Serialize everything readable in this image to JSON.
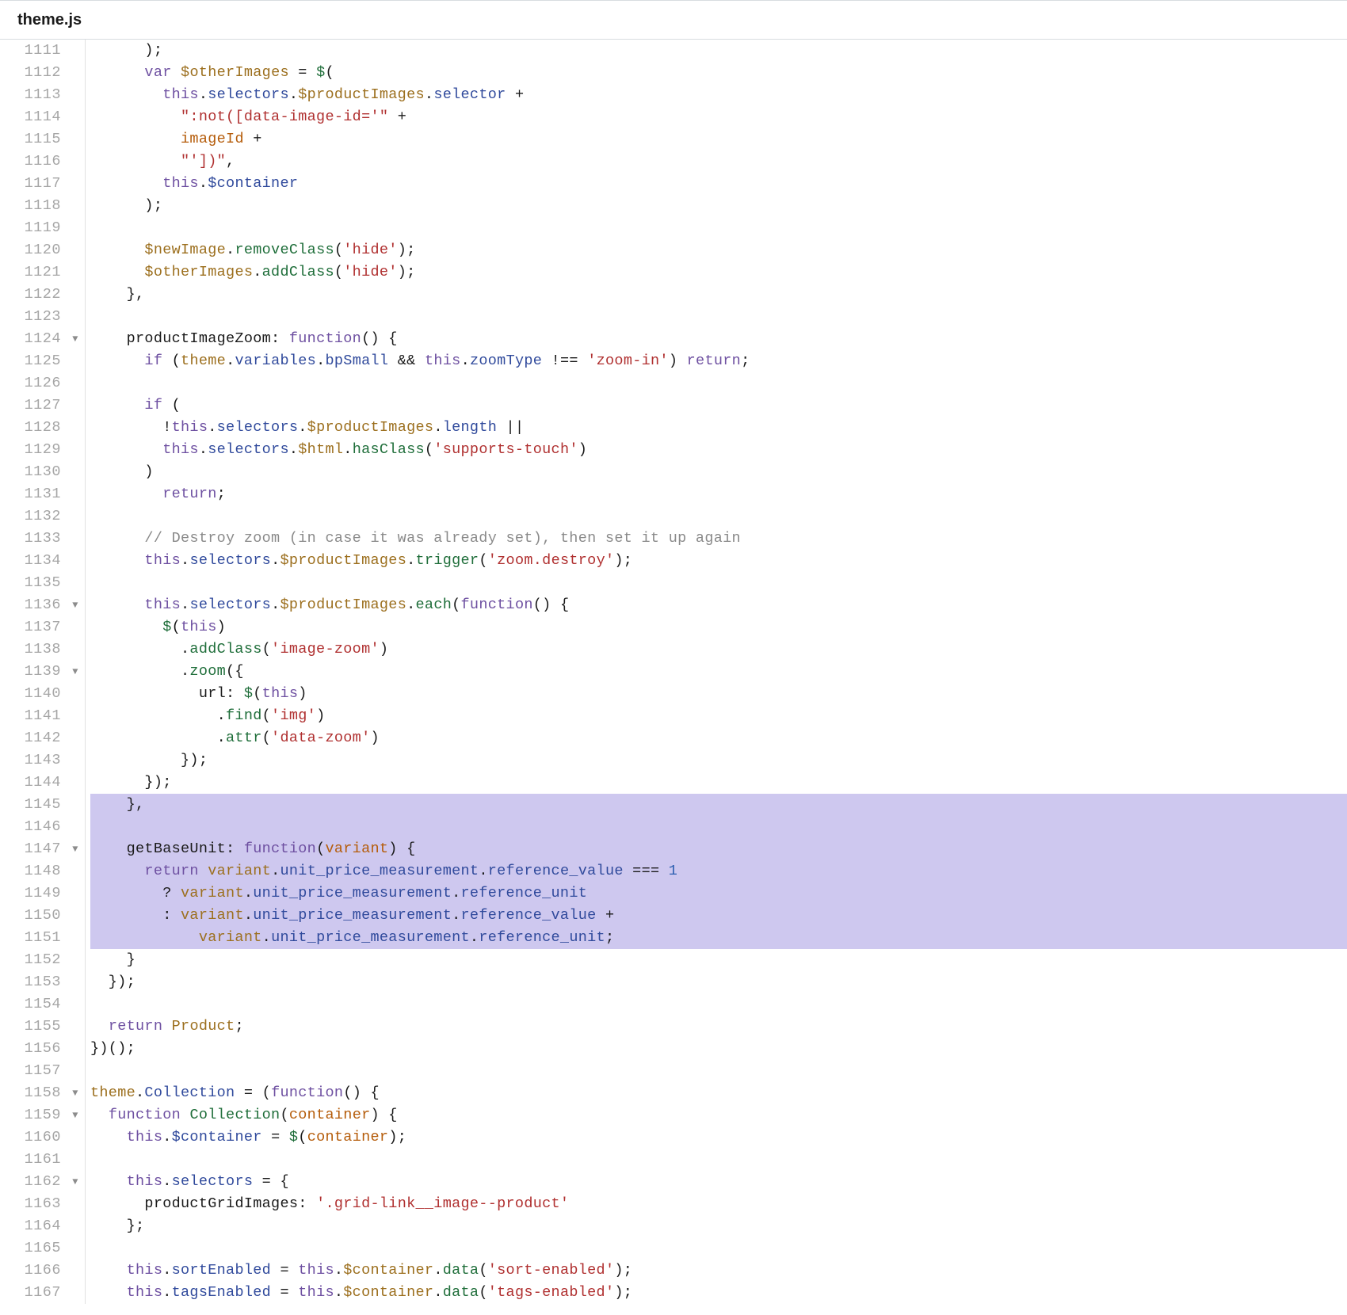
{
  "header": {
    "filename": "theme.js"
  },
  "gutter": {
    "start": 1111,
    "end": 1167,
    "folds": [
      1124,
      1136,
      1139,
      1147,
      1158,
      1159,
      1162
    ]
  },
  "code": {
    "highlight_start": 1145,
    "highlight_end": 1151,
    "lines": {
      "1111": [
        [
          "      );",
          "punc"
        ]
      ],
      "1112": [
        [
          "      ",
          ""
        ],
        [
          "var",
          "kw"
        ],
        [
          " ",
          ""
        ],
        [
          "$otherImages",
          "obj"
        ],
        [
          " ",
          ""
        ],
        [
          "=",
          "op"
        ],
        [
          " ",
          ""
        ],
        [
          "$",
          "fn"
        ],
        [
          "(",
          "punc"
        ]
      ],
      "1113": [
        [
          "        ",
          ""
        ],
        [
          "this",
          "kw"
        ],
        [
          ".",
          "punc"
        ],
        [
          "selectors",
          "prop"
        ],
        [
          ".",
          "punc"
        ],
        [
          "$productImages",
          "obj"
        ],
        [
          ".",
          "punc"
        ],
        [
          "selector",
          "prop"
        ],
        [
          " ",
          ""
        ],
        [
          "+",
          "op"
        ]
      ],
      "1114": [
        [
          "          ",
          ""
        ],
        [
          "\":not([data-image-id='\"",
          "str"
        ],
        [
          " ",
          ""
        ],
        [
          "+",
          "op"
        ]
      ],
      "1115": [
        [
          "          ",
          ""
        ],
        [
          "imageId",
          "param"
        ],
        [
          " ",
          ""
        ],
        [
          "+",
          "op"
        ]
      ],
      "1116": [
        [
          "          ",
          ""
        ],
        [
          "\"'])\"",
          "str"
        ],
        [
          ",",
          "punc"
        ]
      ],
      "1117": [
        [
          "        ",
          ""
        ],
        [
          "this",
          "kw"
        ],
        [
          ".",
          "punc"
        ],
        [
          "$container",
          "prop"
        ]
      ],
      "1118": [
        [
          "      );",
          "punc"
        ]
      ],
      "1119": [
        [
          "",
          ""
        ]
      ],
      "1120": [
        [
          "      ",
          ""
        ],
        [
          "$newImage",
          "obj"
        ],
        [
          ".",
          "punc"
        ],
        [
          "removeClass",
          "fn"
        ],
        [
          "(",
          "punc"
        ],
        [
          "'hide'",
          "str"
        ],
        [
          ");",
          "punc"
        ]
      ],
      "1121": [
        [
          "      ",
          ""
        ],
        [
          "$otherImages",
          "obj"
        ],
        [
          ".",
          "punc"
        ],
        [
          "addClass",
          "fn"
        ],
        [
          "(",
          "punc"
        ],
        [
          "'hide'",
          "str"
        ],
        [
          ");",
          "punc"
        ]
      ],
      "1122": [
        [
          "    },",
          "punc"
        ]
      ],
      "1123": [
        [
          "",
          ""
        ]
      ],
      "1124": [
        [
          "    ",
          ""
        ],
        [
          "productImageZoom",
          "ident"
        ],
        [
          ":",
          "punc"
        ],
        [
          " ",
          ""
        ],
        [
          "function",
          "kw"
        ],
        [
          "()",
          "punc"
        ],
        [
          " ",
          ""
        ],
        [
          "{",
          "punc"
        ]
      ],
      "1125": [
        [
          "      ",
          ""
        ],
        [
          "if",
          "kw"
        ],
        [
          " (",
          "punc"
        ],
        [
          "theme",
          "obj"
        ],
        [
          ".",
          "punc"
        ],
        [
          "variables",
          "prop"
        ],
        [
          ".",
          "punc"
        ],
        [
          "bpSmall",
          "prop"
        ],
        [
          " ",
          ""
        ],
        [
          "&&",
          "op"
        ],
        [
          " ",
          ""
        ],
        [
          "this",
          "kw"
        ],
        [
          ".",
          "punc"
        ],
        [
          "zoomType",
          "prop"
        ],
        [
          " ",
          ""
        ],
        [
          "!==",
          "op"
        ],
        [
          " ",
          ""
        ],
        [
          "'zoom-in'",
          "str"
        ],
        [
          ")",
          "punc"
        ],
        [
          " ",
          ""
        ],
        [
          "return",
          "kw"
        ],
        [
          ";",
          "punc"
        ]
      ],
      "1126": [
        [
          "",
          ""
        ]
      ],
      "1127": [
        [
          "      ",
          ""
        ],
        [
          "if",
          "kw"
        ],
        [
          " (",
          "punc"
        ]
      ],
      "1128": [
        [
          "        ",
          ""
        ],
        [
          "!",
          "op"
        ],
        [
          "this",
          "kw"
        ],
        [
          ".",
          "punc"
        ],
        [
          "selectors",
          "prop"
        ],
        [
          ".",
          "punc"
        ],
        [
          "$productImages",
          "obj"
        ],
        [
          ".",
          "punc"
        ],
        [
          "length",
          "prop"
        ],
        [
          " ",
          ""
        ],
        [
          "||",
          "op"
        ]
      ],
      "1129": [
        [
          "        ",
          ""
        ],
        [
          "this",
          "kw"
        ],
        [
          ".",
          "punc"
        ],
        [
          "selectors",
          "prop"
        ],
        [
          ".",
          "punc"
        ],
        [
          "$html",
          "obj"
        ],
        [
          ".",
          "punc"
        ],
        [
          "hasClass",
          "fn"
        ],
        [
          "(",
          "punc"
        ],
        [
          "'supports-touch'",
          "str"
        ],
        [
          ")",
          "punc"
        ]
      ],
      "1130": [
        [
          "      )",
          "punc"
        ]
      ],
      "1131": [
        [
          "        ",
          ""
        ],
        [
          "return",
          "kw"
        ],
        [
          ";",
          "punc"
        ]
      ],
      "1132": [
        [
          "",
          ""
        ]
      ],
      "1133": [
        [
          "      ",
          ""
        ],
        [
          "// Destroy zoom (in case it was already set), then set it up again",
          "cmt"
        ]
      ],
      "1134": [
        [
          "      ",
          ""
        ],
        [
          "this",
          "kw"
        ],
        [
          ".",
          "punc"
        ],
        [
          "selectors",
          "prop"
        ],
        [
          ".",
          "punc"
        ],
        [
          "$productImages",
          "obj"
        ],
        [
          ".",
          "punc"
        ],
        [
          "trigger",
          "fn"
        ],
        [
          "(",
          "punc"
        ],
        [
          "'zoom.destroy'",
          "str"
        ],
        [
          ");",
          "punc"
        ]
      ],
      "1135": [
        [
          "",
          ""
        ]
      ],
      "1136": [
        [
          "      ",
          ""
        ],
        [
          "this",
          "kw"
        ],
        [
          ".",
          "punc"
        ],
        [
          "selectors",
          "prop"
        ],
        [
          ".",
          "punc"
        ],
        [
          "$productImages",
          "obj"
        ],
        [
          ".",
          "punc"
        ],
        [
          "each",
          "fn"
        ],
        [
          "(",
          "punc"
        ],
        [
          "function",
          "kw"
        ],
        [
          "()",
          "punc"
        ],
        [
          " {",
          "punc"
        ]
      ],
      "1137": [
        [
          "        ",
          ""
        ],
        [
          "$",
          "fn"
        ],
        [
          "(",
          "punc"
        ],
        [
          "this",
          "kw"
        ],
        [
          ")",
          "punc"
        ]
      ],
      "1138": [
        [
          "          .",
          "punc"
        ],
        [
          "addClass",
          "fn"
        ],
        [
          "(",
          "punc"
        ],
        [
          "'image-zoom'",
          "str"
        ],
        [
          ")",
          "punc"
        ]
      ],
      "1139": [
        [
          "          .",
          "punc"
        ],
        [
          "zoom",
          "fn"
        ],
        [
          "({",
          "punc"
        ]
      ],
      "1140": [
        [
          "            ",
          ""
        ],
        [
          "url",
          "ident"
        ],
        [
          ":",
          "punc"
        ],
        [
          " ",
          ""
        ],
        [
          "$",
          "fn"
        ],
        [
          "(",
          "punc"
        ],
        [
          "this",
          "kw"
        ],
        [
          ")",
          "punc"
        ]
      ],
      "1141": [
        [
          "              .",
          "punc"
        ],
        [
          "find",
          "fn"
        ],
        [
          "(",
          "punc"
        ],
        [
          "'img'",
          "str"
        ],
        [
          ")",
          "punc"
        ]
      ],
      "1142": [
        [
          "              .",
          "punc"
        ],
        [
          "attr",
          "fn"
        ],
        [
          "(",
          "punc"
        ],
        [
          "'data-zoom'",
          "str"
        ],
        [
          ")",
          "punc"
        ]
      ],
      "1143": [
        [
          "          });",
          "punc"
        ]
      ],
      "1144": [
        [
          "      });",
          "punc"
        ]
      ],
      "1145": [
        [
          "    },",
          "punc"
        ]
      ],
      "1146": [
        [
          "",
          ""
        ]
      ],
      "1147": [
        [
          "    ",
          ""
        ],
        [
          "getBaseUnit",
          "ident"
        ],
        [
          ":",
          "punc"
        ],
        [
          " ",
          ""
        ],
        [
          "function",
          "kw"
        ],
        [
          "(",
          "punc"
        ],
        [
          "variant",
          "param"
        ],
        [
          ")",
          "punc"
        ],
        [
          " {",
          "punc"
        ]
      ],
      "1148": [
        [
          "      ",
          ""
        ],
        [
          "return",
          "kw"
        ],
        [
          " ",
          ""
        ],
        [
          "variant",
          "obj"
        ],
        [
          ".",
          "punc"
        ],
        [
          "unit_price_measurement",
          "prop"
        ],
        [
          ".",
          "punc"
        ],
        [
          "reference_value",
          "prop"
        ],
        [
          " ",
          ""
        ],
        [
          "===",
          "op"
        ],
        [
          " ",
          ""
        ],
        [
          "1",
          "num"
        ]
      ],
      "1149": [
        [
          "        ",
          ""
        ],
        [
          "?",
          "op"
        ],
        [
          " ",
          ""
        ],
        [
          "variant",
          "obj"
        ],
        [
          ".",
          "punc"
        ],
        [
          "unit_price_measurement",
          "prop"
        ],
        [
          ".",
          "punc"
        ],
        [
          "reference_unit",
          "prop"
        ]
      ],
      "1150": [
        [
          "        ",
          ""
        ],
        [
          ":",
          "op"
        ],
        [
          " ",
          ""
        ],
        [
          "variant",
          "obj"
        ],
        [
          ".",
          "punc"
        ],
        [
          "unit_price_measurement",
          "prop"
        ],
        [
          ".",
          "punc"
        ],
        [
          "reference_value",
          "prop"
        ],
        [
          " ",
          ""
        ],
        [
          "+",
          "op"
        ]
      ],
      "1151": [
        [
          "            ",
          ""
        ],
        [
          "variant",
          "obj"
        ],
        [
          ".",
          "punc"
        ],
        [
          "unit_price_measurement",
          "prop"
        ],
        [
          ".",
          "punc"
        ],
        [
          "reference_unit",
          "prop"
        ],
        [
          ";",
          "punc"
        ]
      ],
      "1152": [
        [
          "    }",
          "punc"
        ]
      ],
      "1153": [
        [
          "  });",
          "punc"
        ]
      ],
      "1154": [
        [
          "",
          ""
        ]
      ],
      "1155": [
        [
          "  ",
          ""
        ],
        [
          "return",
          "kw"
        ],
        [
          " ",
          ""
        ],
        [
          "Product",
          "obj"
        ],
        [
          ";",
          "punc"
        ]
      ],
      "1156": [
        [
          "})();",
          "punc"
        ]
      ],
      "1157": [
        [
          "",
          ""
        ]
      ],
      "1158": [
        [
          "",
          ""
        ],
        [
          "theme",
          "obj"
        ],
        [
          ".",
          "punc"
        ],
        [
          "Collection",
          "prop"
        ],
        [
          " ",
          ""
        ],
        [
          "=",
          "op"
        ],
        [
          " (",
          "punc"
        ],
        [
          "function",
          "kw"
        ],
        [
          "()",
          "punc"
        ],
        [
          " {",
          "punc"
        ]
      ],
      "1159": [
        [
          "  ",
          ""
        ],
        [
          "function",
          "kw"
        ],
        [
          " ",
          ""
        ],
        [
          "Collection",
          "type"
        ],
        [
          "(",
          "punc"
        ],
        [
          "container",
          "param"
        ],
        [
          ")",
          "punc"
        ],
        [
          " {",
          "punc"
        ]
      ],
      "1160": [
        [
          "    ",
          ""
        ],
        [
          "this",
          "kw"
        ],
        [
          ".",
          "punc"
        ],
        [
          "$container",
          "prop"
        ],
        [
          " ",
          ""
        ],
        [
          "=",
          "op"
        ],
        [
          " ",
          ""
        ],
        [
          "$",
          "fn"
        ],
        [
          "(",
          "punc"
        ],
        [
          "container",
          "param"
        ],
        [
          ");",
          "punc"
        ]
      ],
      "1161": [
        [
          "",
          ""
        ]
      ],
      "1162": [
        [
          "    ",
          ""
        ],
        [
          "this",
          "kw"
        ],
        [
          ".",
          "punc"
        ],
        [
          "selectors",
          "prop"
        ],
        [
          " ",
          ""
        ],
        [
          "=",
          "op"
        ],
        [
          " {",
          "punc"
        ]
      ],
      "1163": [
        [
          "      ",
          ""
        ],
        [
          "productGridImages",
          "ident"
        ],
        [
          ":",
          "punc"
        ],
        [
          " ",
          ""
        ],
        [
          "'.grid-link__image--product'",
          "str"
        ]
      ],
      "1164": [
        [
          "    };",
          "punc"
        ]
      ],
      "1165": [
        [
          "",
          ""
        ]
      ],
      "1166": [
        [
          "    ",
          ""
        ],
        [
          "this",
          "kw"
        ],
        [
          ".",
          "punc"
        ],
        [
          "sortEnabled",
          "prop"
        ],
        [
          " ",
          ""
        ],
        [
          "=",
          "op"
        ],
        [
          " ",
          ""
        ],
        [
          "this",
          "kw"
        ],
        [
          ".",
          "punc"
        ],
        [
          "$container",
          "obj"
        ],
        [
          ".",
          "punc"
        ],
        [
          "data",
          "fn"
        ],
        [
          "(",
          "punc"
        ],
        [
          "'sort-enabled'",
          "str"
        ],
        [
          ");",
          "punc"
        ]
      ],
      "1167": [
        [
          "    ",
          ""
        ],
        [
          "this",
          "kw"
        ],
        [
          ".",
          "punc"
        ],
        [
          "tagsEnabled",
          "prop"
        ],
        [
          " ",
          ""
        ],
        [
          "=",
          "op"
        ],
        [
          " ",
          ""
        ],
        [
          "this",
          "kw"
        ],
        [
          ".",
          "punc"
        ],
        [
          "$container",
          "obj"
        ],
        [
          ".",
          "punc"
        ],
        [
          "data",
          "fn"
        ],
        [
          "(",
          "punc"
        ],
        [
          "'tags-enabled'",
          "str"
        ],
        [
          ");",
          "punc"
        ]
      ]
    }
  }
}
